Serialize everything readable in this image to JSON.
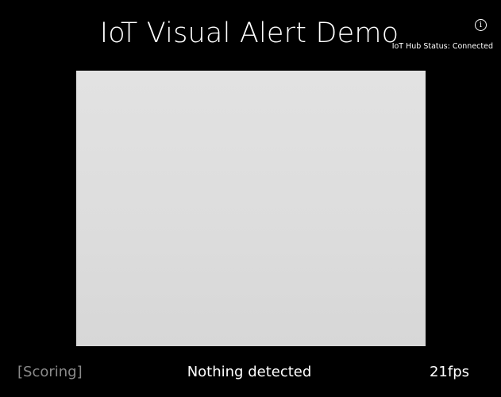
{
  "header": {
    "title": "IoT Visual Alert Demo",
    "info_glyph": "i",
    "info_icon": "info-icon",
    "hub_status": "IoT Hub Status: Connected"
  },
  "camera": {
    "feed_color": "#dddddd"
  },
  "footer": {
    "status": "[Scoring]",
    "detection": "Nothing detected",
    "fps": "21fps"
  },
  "colors": {
    "background": "#000000",
    "text": "#ffffff",
    "muted_text": "#8a8a8a"
  }
}
